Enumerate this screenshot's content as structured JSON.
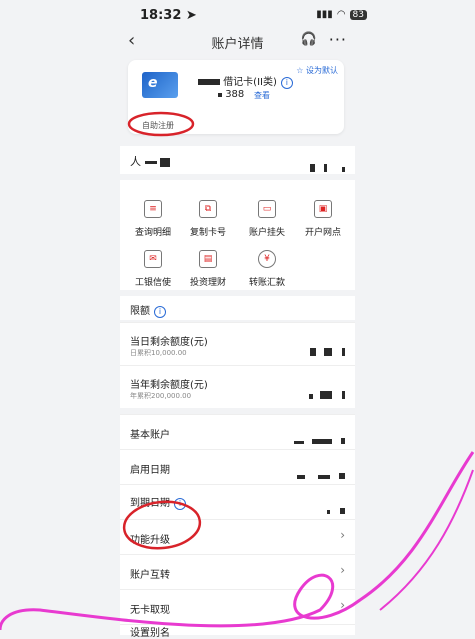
{
  "status": {
    "time": "18:32",
    "battery": "83"
  },
  "nav": {
    "title": "账户详情"
  },
  "card": {
    "type": "借记卡(II类)",
    "number": "388",
    "view": "查看",
    "set_default": "设为默认",
    "self_register": "自助注册"
  },
  "owner": {
    "label": "人"
  },
  "grid": [
    {
      "label": "查询明细",
      "icon": "document-icon"
    },
    {
      "label": "复制卡号",
      "icon": "copy-icon"
    },
    {
      "label": "账户挂失",
      "icon": "report-loss-icon"
    },
    {
      "label": "开户网点",
      "icon": "branch-icon"
    },
    {
      "label": "工银信使",
      "icon": "mail-icon"
    },
    {
      "label": "投资理财",
      "icon": "invest-icon"
    },
    {
      "label": "转账汇款",
      "icon": "transfer-icon"
    }
  ],
  "limits": {
    "title": "限额",
    "daily": {
      "label": "当日剩余额度(元)",
      "sub": "日累积10,000.00"
    },
    "yearly": {
      "label": "当年剩余额度(元)",
      "sub": "年累积200,000.00"
    }
  },
  "rows": {
    "basic_account": "基本账户",
    "open_date": "启用日期",
    "expire_date": "到期日期",
    "upgrade": "功能升级",
    "transfer": "账户互转",
    "cardless": "无卡取现",
    "alias": "设置别名"
  },
  "colors": {
    "accent": "#2a6bd6",
    "annotation_red": "#d8232a",
    "annotation_pink": "#e83ad0"
  }
}
